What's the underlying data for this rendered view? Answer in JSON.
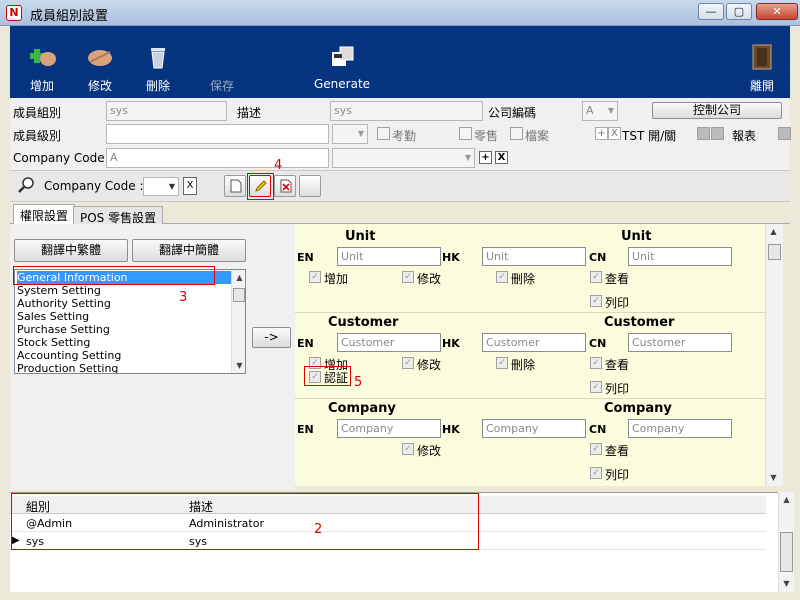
{
  "window": {
    "title": "成員組別設置",
    "min": "—",
    "max": "▢",
    "close": "✕"
  },
  "toolbar": {
    "add": "增加",
    "edit": "修改",
    "delete": "刪除",
    "save": "保存",
    "generate": "Generate",
    "exit": "離開"
  },
  "form": {
    "group_label": "成員組別",
    "group_value": "sys",
    "desc_label": "描述",
    "desc_value": "sys",
    "company_no_label": "公司編碼",
    "company_no_value": "A",
    "control_company_button": "控制公司",
    "level_label": "成員級別",
    "attendance": "考勤",
    "retail": "零售",
    "archive": "檔案",
    "tst_label": "TST 開/關",
    "report": "報表",
    "company_code_label": "Company Code :",
    "company_code_value": "A",
    "plus": "+",
    "x": "X"
  },
  "subbar": {
    "company_code_label": "Company Code :",
    "x": "X"
  },
  "tabs": [
    {
      "label": "權限設置"
    },
    {
      "label": "POS 零售設置"
    }
  ],
  "left": {
    "btn_trad": "翻譯中繁體",
    "btn_simp": "翻譯中簡體",
    "arrow_button": "->",
    "list": [
      "General Information",
      "System Setting",
      "Authority Setting",
      "Sales Setting",
      "Purchase Setting",
      "Stock Setting",
      "Accounting Setting",
      "Production Setting"
    ]
  },
  "sections": [
    {
      "head_left": "Unit",
      "head_right": "Unit",
      "en": "Unit",
      "hk": "Unit",
      "cn": "Unit",
      "perms": [
        "增加",
        "修改",
        "刪除",
        "查看",
        "列印"
      ]
    },
    {
      "head_left": "Customer",
      "head_right": "Customer",
      "en": "Customer",
      "hk": "Customer",
      "cn": "Customer",
      "perms": [
        "增加",
        "修改",
        "刪除",
        "查看",
        "認証",
        "列印"
      ]
    },
    {
      "head_left": "Company",
      "head_right": "Company",
      "en": "Company",
      "hk": "Company",
      "cn": "Company",
      "perms": [
        "修改",
        "查看",
        "列印"
      ]
    }
  ],
  "lang": {
    "en": "EN",
    "hk": "HK",
    "cn": "CN"
  },
  "grid": {
    "headers": [
      "組別",
      "描述"
    ],
    "rows": [
      [
        "@Admin",
        "Administrator"
      ],
      [
        "sys",
        "sys"
      ]
    ]
  },
  "annotations": {
    "n2": "2",
    "n3": "3",
    "n4": "4",
    "n5": "5"
  },
  "colors": {
    "toolbar_bg": "#07347f",
    "panel_bg": "#fbfbdd",
    "highlight_red": "#dd0000",
    "selection": "#3399ff"
  }
}
